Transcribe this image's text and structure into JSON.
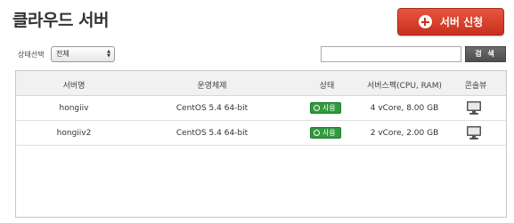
{
  "page": {
    "title": "클라우드 서버"
  },
  "actions": {
    "apply_label": "서버 신청"
  },
  "filter": {
    "label": "상태선택",
    "selected": "전체"
  },
  "search": {
    "placeholder": "",
    "button_label": "검 색"
  },
  "table": {
    "columns": [
      "서버명",
      "운영체제",
      "상태",
      "서버스펙(CPU, RAM)",
      "콘솔뷰"
    ],
    "rows": [
      {
        "name": "hongiiv",
        "os": "CentOS 5.4 64-bit",
        "status": "사용",
        "spec": "4 vCore, 8.00 GB",
        "console_icon": "monitor-icon"
      },
      {
        "name": "hongiiv2",
        "os": "CentOS 5.4 64-bit",
        "status": "사용",
        "spec": "2 vCore, 2.00 GB",
        "console_icon": "monitor-icon"
      }
    ]
  },
  "colors": {
    "accent": "#d63d27",
    "status_green": "#2f9a3e",
    "header_bg": "#f1f1f1"
  }
}
